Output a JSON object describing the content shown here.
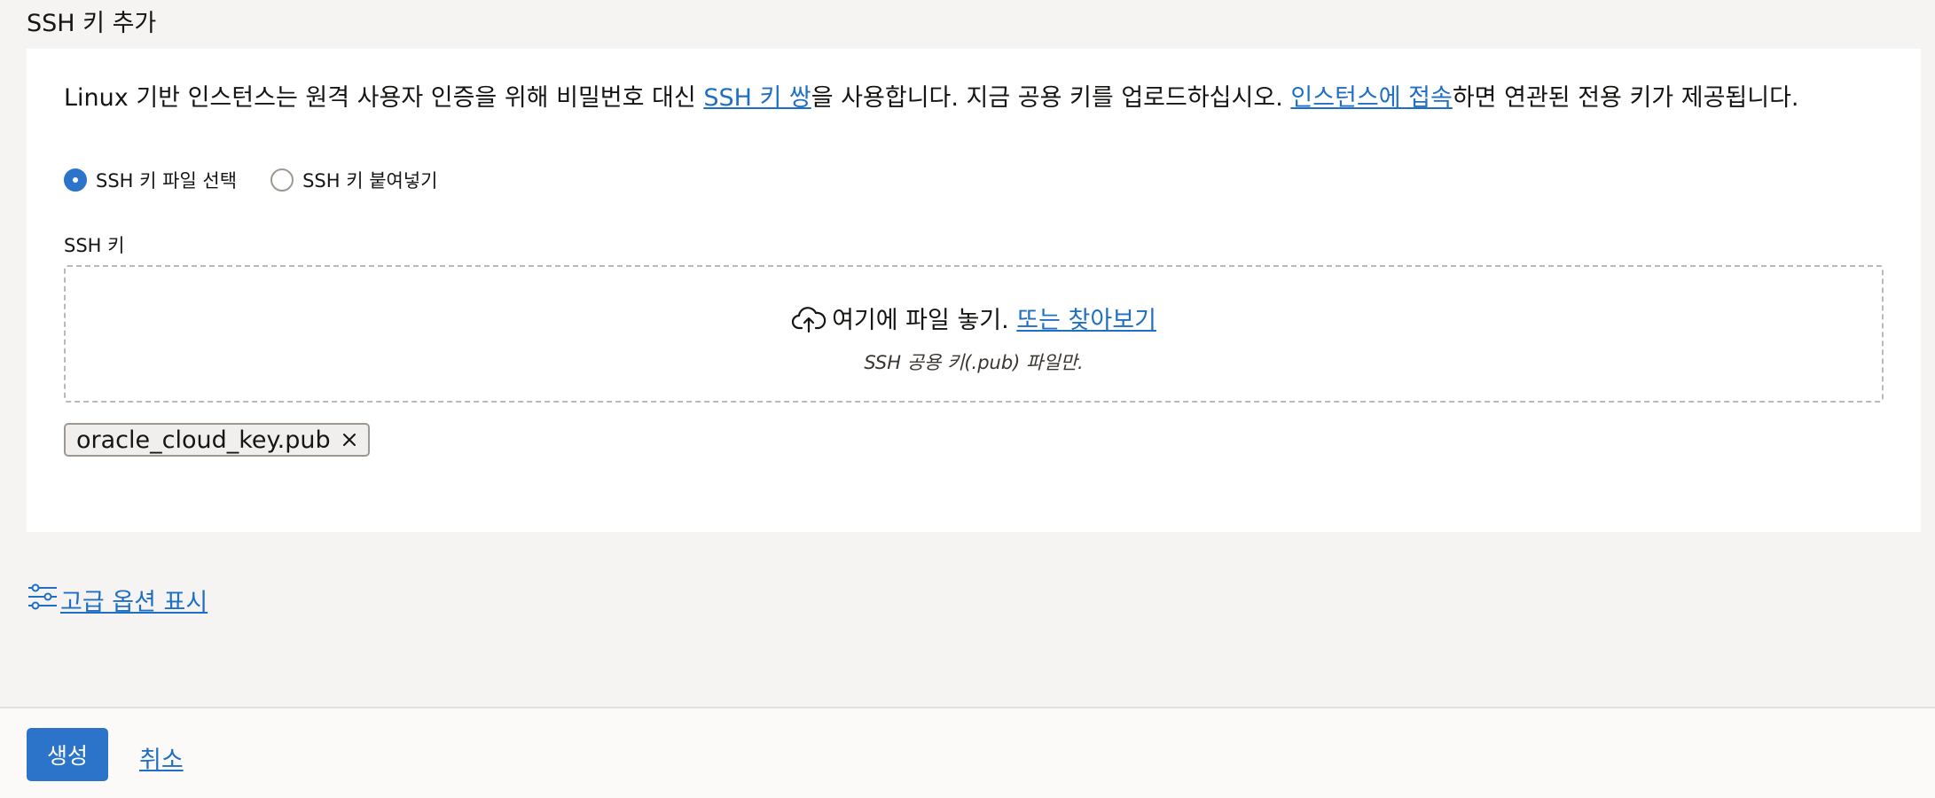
{
  "section": {
    "title": "SSH 키 추가"
  },
  "description": {
    "text_1": "Linux 기반 인스턴스는 원격 사용자 인증을 위해 비밀번호 대신 ",
    "link_ssh_keypair": "SSH 키 쌍",
    "text_2": "을 사용합니다. 지금 공용 키를 업로드하십시오. ",
    "link_connect": "인스턴스에 접속",
    "text_3": "하면 연관된 전용 키가 제공됩니다."
  },
  "radio": {
    "options": [
      {
        "label": "SSH 키 파일 선택",
        "selected": true
      },
      {
        "label": "SSH 키 붙여넣기",
        "selected": false
      }
    ]
  },
  "ssh_key": {
    "label": "SSH 키",
    "dropzone_text": "여기에 파일 놓기. ",
    "browse_link": "또는 찾아보기",
    "hint": "SSH 공용 키(.pub) 파일만.",
    "uploaded_file": "oracle_cloud_key.pub"
  },
  "advanced": {
    "label": "고급 옵션 표시"
  },
  "footer": {
    "create_label": "생성",
    "cancel_label": "취소"
  },
  "colors": {
    "accent": "#2b74c9",
    "link": "#1f6fc5",
    "background": "#f5f4f2"
  }
}
